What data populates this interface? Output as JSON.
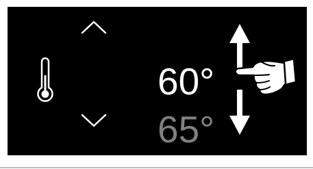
{
  "thermostat": {
    "current_temp": "60°",
    "next_temp": "65°",
    "icons": {
      "mode": "thermometer-icon",
      "increase": "chevron-up-icon",
      "decrease": "chevron-down-icon",
      "gesture_arrow": "vertical-double-arrow-icon",
      "gesture_hand": "pointing-hand-icon"
    },
    "colors": {
      "background": "#000000",
      "primary_text": "#ffffff",
      "secondary_text": "#808080"
    }
  }
}
